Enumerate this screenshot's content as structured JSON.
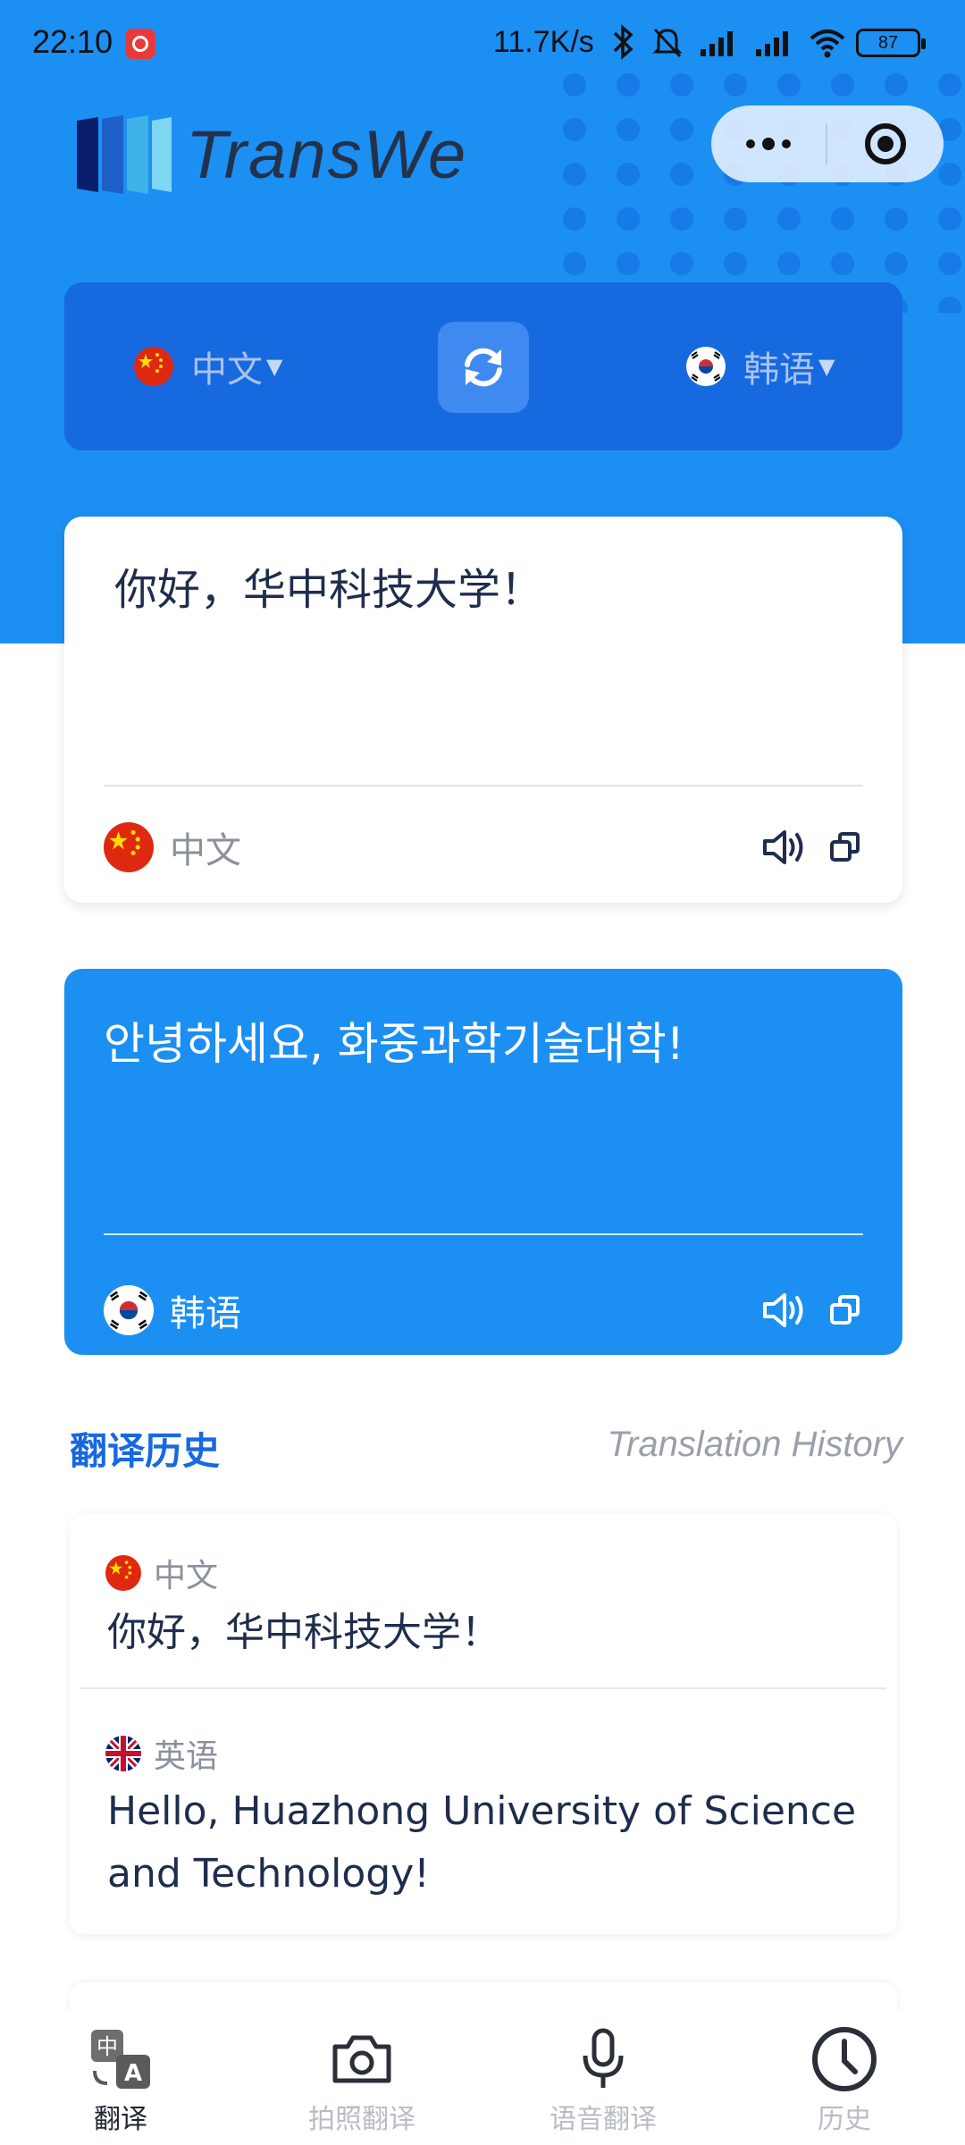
{
  "status_bar": {
    "time": "22:10",
    "network_speed": "11.7K/s",
    "battery": "87"
  },
  "header": {
    "logo_text": "TransWe"
  },
  "language_bar": {
    "source_language": "中文",
    "target_language": "韩语"
  },
  "source_card": {
    "text": "你好，华中科技大学！",
    "language": "中文"
  },
  "result_card": {
    "text": "안녕하세요, 화중과학기술대학!",
    "language": "韩语"
  },
  "history": {
    "title": "翻译历史",
    "subtitle": "Translation History",
    "items": [
      {
        "source_language": "中文",
        "source_text": "你好，华中科技大学！",
        "target_language": "英语",
        "target_text": "Hello, Huazhong University of Science and Technology!"
      }
    ]
  },
  "tabbar": {
    "tabs": [
      {
        "label": "翻译",
        "icon": "translate-icon",
        "active": true
      },
      {
        "label": "拍照翻译",
        "icon": "camera-icon",
        "active": false
      },
      {
        "label": "语音翻译",
        "icon": "microphone-icon",
        "active": false
      },
      {
        "label": "历史",
        "icon": "clock-icon",
        "active": false
      }
    ]
  },
  "colors": {
    "primary": "#1c8ff3",
    "primary_dark": "#1769e0",
    "text_dark": "#1f2d4d",
    "text_muted": "#8a909c"
  }
}
